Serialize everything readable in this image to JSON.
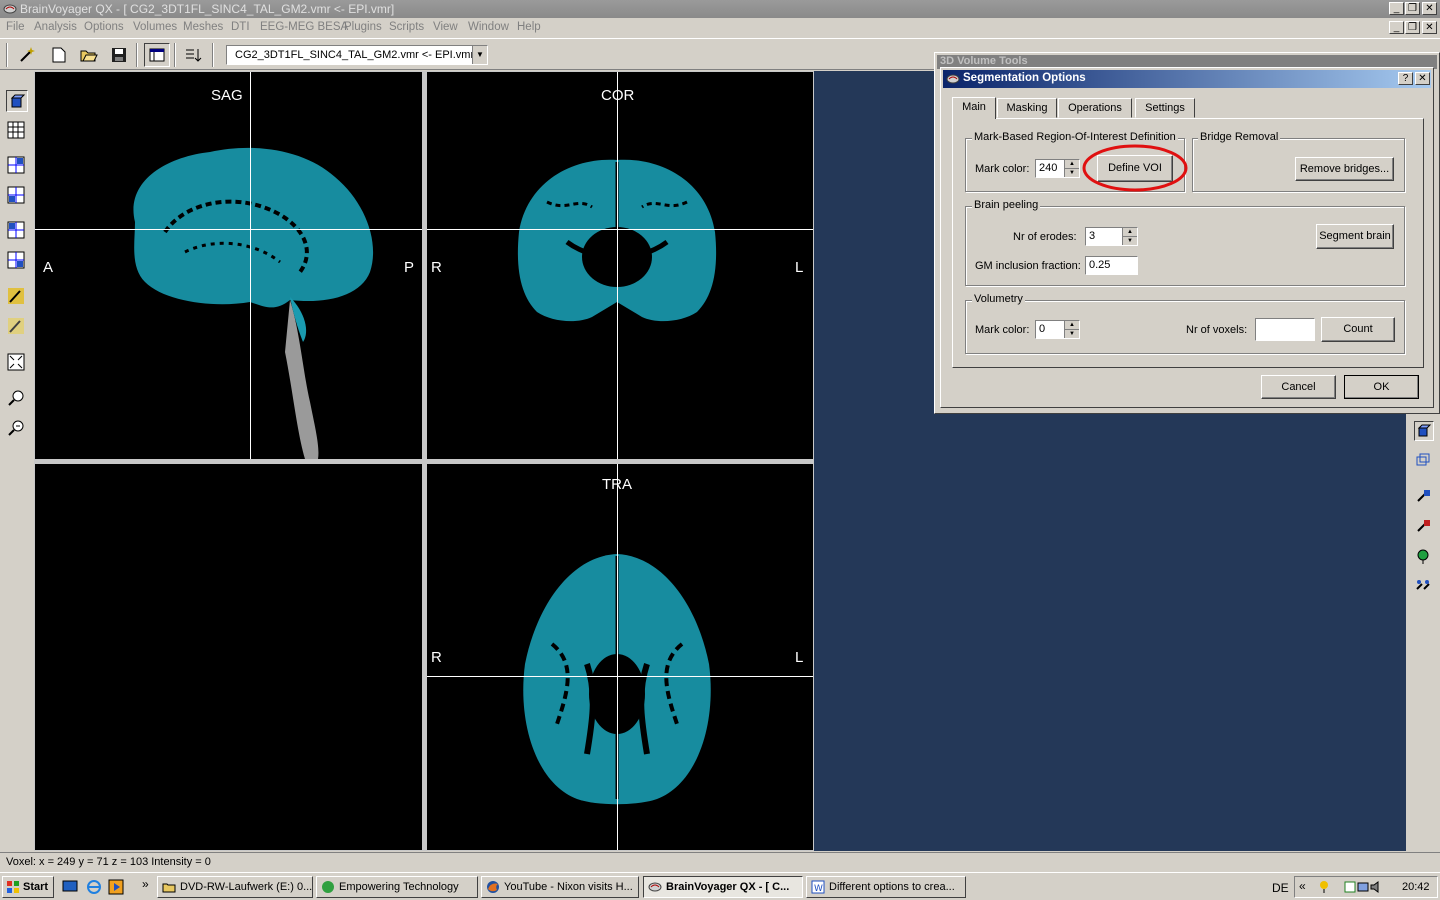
{
  "window": {
    "title": "BrainVoyager QX - [ CG2_3DT1FL_SINC4_TAL_GM2.vmr  <-  EPI.vmr]",
    "min_label": "_",
    "restore_label": "❐",
    "close_label": "✕"
  },
  "menu": [
    "File",
    "Analysis",
    "Options",
    "Volumes",
    "Meshes",
    "DTI",
    "EEG-MEG BESA",
    "Plugins",
    "Scripts",
    "View",
    "Window",
    "Help"
  ],
  "toolbar": {
    "file_selector": "CG2_3DT1FL_SINC4_TAL_GM2.vmr  <-  EPI.vmr",
    "dropdown_arrow": "▼"
  },
  "viewer": {
    "sag": {
      "title": "SAG",
      "left": "A",
      "right": "P"
    },
    "cor": {
      "title": "COR",
      "left": "R",
      "right": "L"
    },
    "tra": {
      "title": "TRA",
      "left": "R",
      "right": "L"
    }
  },
  "volume_tools": {
    "title": "3D Volume Tools"
  },
  "dialog": {
    "title": "Segmentation Options",
    "help_label": "?",
    "close_label": "✕",
    "tabs": [
      "Main",
      "Masking",
      "Operations",
      "Settings"
    ],
    "active_tab": "Main",
    "roi": {
      "group_label": "Mark-Based Region-Of-Interest Definition",
      "mark_color_label": "Mark color:",
      "mark_color_value": "240",
      "define_voi_button": "Define VOI"
    },
    "bridge": {
      "group_label": "Bridge Removal",
      "remove_bridges_button": "Remove bridges..."
    },
    "peeling": {
      "group_label": "Brain peeling",
      "erodes_label": "Nr of erodes:",
      "erodes_value": "3",
      "gm_label": "GM inclusion fraction:",
      "gm_value": "0.25",
      "segment_button": "Segment brain"
    },
    "volumetry": {
      "group_label": "Volumetry",
      "mark_color_label": "Mark color:",
      "mark_color_value": "0",
      "voxels_label": "Nr of voxels:",
      "voxels_value": "",
      "count_button": "Count"
    },
    "cancel_button": "Cancel",
    "ok_button": "OK"
  },
  "status": "Voxel:  x = 249 y = 71 z = 103  Intensity = 0",
  "taskbar": {
    "start": "Start",
    "chevron": "»",
    "tasks": [
      {
        "label": "DVD-RW-Laufwerk (E:) 0...",
        "active": false
      },
      {
        "label": "Empowering Technology",
        "active": false
      },
      {
        "label": "YouTube - Nixon visits H...",
        "active": false
      },
      {
        "label": "BrainVoyager QX - [ C...",
        "active": true
      },
      {
        "label": "Different options to crea...",
        "active": false
      }
    ],
    "lang": "DE",
    "tray_chevron": "«",
    "time": "20:42"
  },
  "colors": {
    "brain": "#1a9bb0",
    "viewer_bg": "#000000",
    "workspace": "#243858",
    "highlight": "#e01010"
  }
}
